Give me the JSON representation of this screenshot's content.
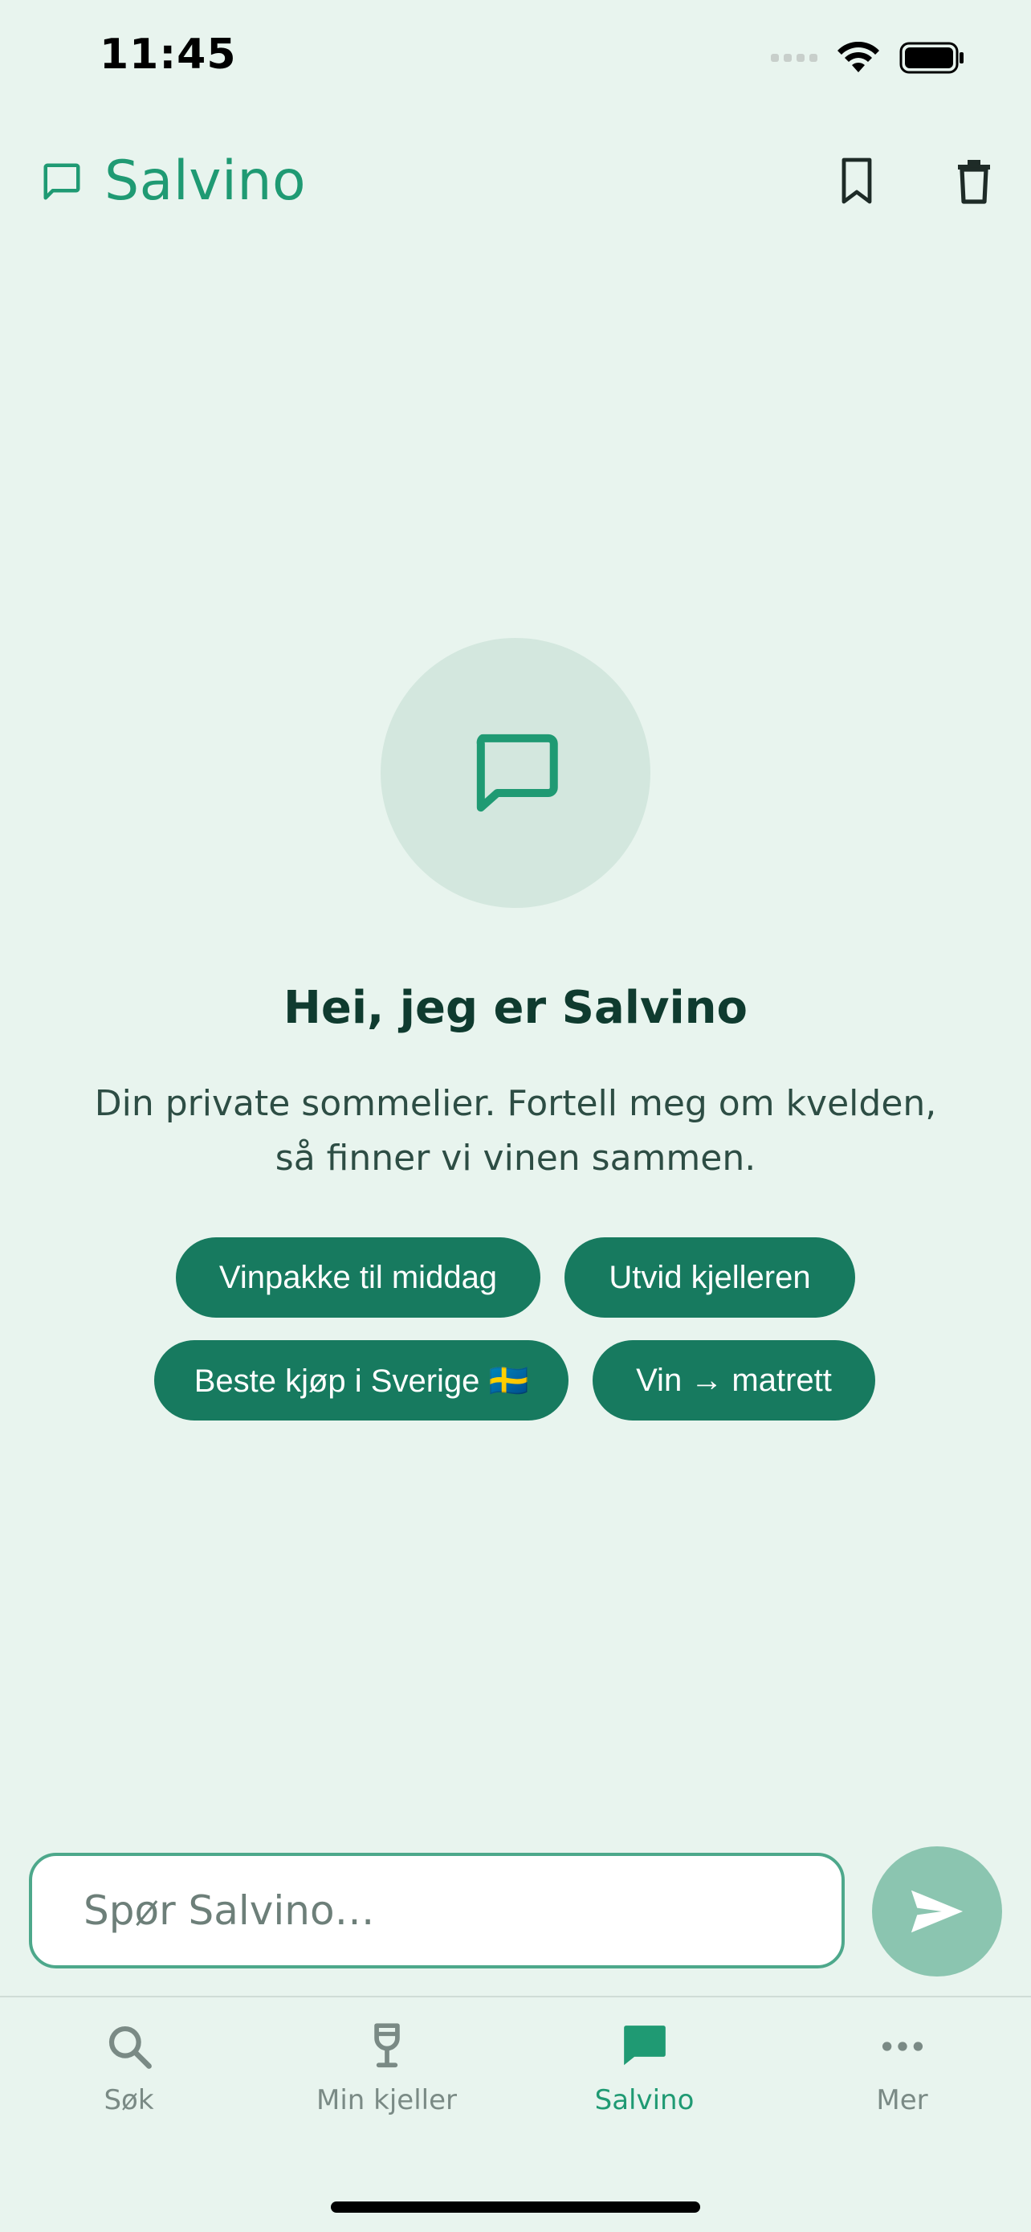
{
  "status_bar": {
    "time": "11:45"
  },
  "header": {
    "title": "Salvino",
    "bookmark_icon": "bookmark-icon",
    "delete_icon": "trash-icon"
  },
  "empty_state": {
    "icon": "chat-bubble-icon",
    "headline": "Hei, jeg er Salvino",
    "subtitle_line1": "Din private sommelier. Fortell meg om kvelden,",
    "subtitle_line2": "så finner vi vinen sammen.",
    "suggestions": [
      {
        "label": "Vinpakke til middag"
      },
      {
        "label": "Utvid kjelleren"
      },
      {
        "label": "Beste kjøp i Sverige 🇸🇪"
      },
      {
        "label": "Vin → matrett"
      }
    ]
  },
  "composer": {
    "placeholder": "Spør Salvino…",
    "value": "",
    "send_icon": "send-icon"
  },
  "tabbar": {
    "tabs": [
      {
        "label": "Søk",
        "icon": "search-icon",
        "active": false
      },
      {
        "label": "Min kjeller",
        "icon": "wine-glass-icon",
        "active": false
      },
      {
        "label": "Salvino",
        "icon": "chat-bubble-icon",
        "active": true
      },
      {
        "label": "Mer",
        "icon": "more-icon",
        "active": false
      }
    ]
  },
  "colors": {
    "background": "#e8f4ee",
    "accent": "#1f9a73",
    "chip": "#177a5f",
    "send_disabled": "#8bc5b0"
  }
}
